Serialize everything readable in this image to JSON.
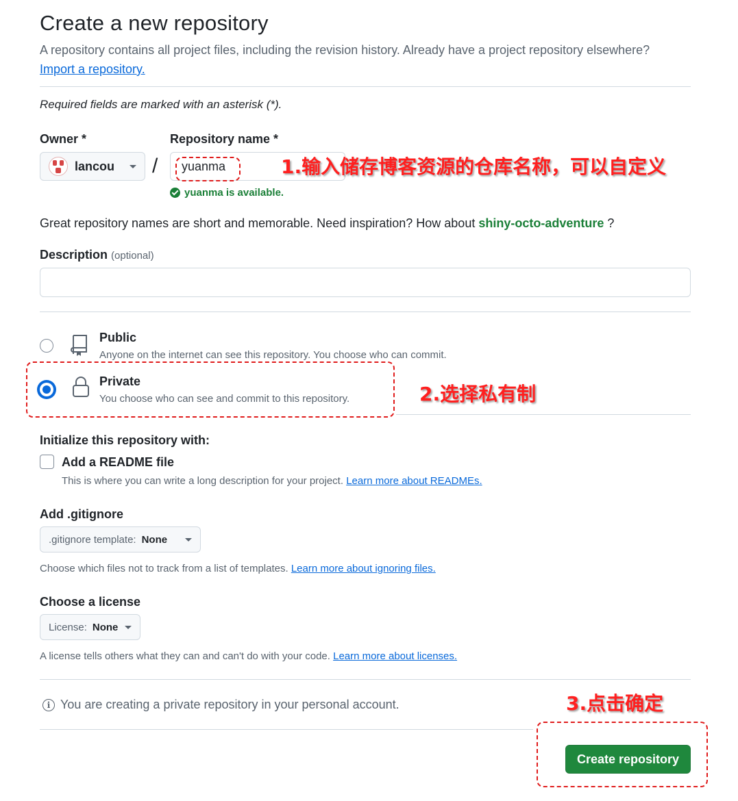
{
  "header": {
    "title": "Create a new repository",
    "subtitle": "A repository contains all project files, including the revision history. Already have a project repository elsewhere?",
    "import_link": "Import a repository."
  },
  "required_note": "Required fields are marked with an asterisk (*).",
  "owner": {
    "label": "Owner *",
    "value": "lancou"
  },
  "separator": "/",
  "repo_name": {
    "label": "Repository name *",
    "value": "yuanma",
    "availability": "yuanma is available."
  },
  "inspiration": {
    "text": "Great repository names are short and memorable. Need inspiration? How about",
    "suggestion": "shiny-octo-adventure",
    "suffix": "?"
  },
  "description": {
    "label": "Description",
    "optional": "(optional)",
    "value": ""
  },
  "visibility": {
    "selected": "private",
    "public": {
      "title": "Public",
      "desc": "Anyone on the internet can see this repository. You choose who can commit."
    },
    "private": {
      "title": "Private",
      "desc": "You choose who can see and commit to this repository."
    }
  },
  "init": {
    "heading": "Initialize this repository with:",
    "readme_label": "Add a README file",
    "readme_checked": false,
    "readme_help": "This is where you can write a long description for your project.",
    "readme_link": "Learn more about READMEs."
  },
  "gitignore": {
    "heading": "Add .gitignore",
    "select_prefix": ".gitignore template:",
    "select_value": "None",
    "help": "Choose which files not to track from a list of templates.",
    "link": "Learn more about ignoring files."
  },
  "license": {
    "heading": "Choose a license",
    "select_prefix": "License:",
    "select_value": "None",
    "help": "A license tells others what they can and can't do with your code.",
    "link": "Learn more about licenses."
  },
  "info_note": "You are creating a private repository in your personal account.",
  "create_button": "Create repository",
  "annotations": {
    "step1": "1.输入储存博客资源的仓库名称，可以自定义",
    "step2": "2.选择私有制",
    "step3": "3.点击确定"
  },
  "colors": {
    "primary_green": "#1f883d",
    "link_blue": "#0969da",
    "annotation_red": "#ff1f1f",
    "success_green": "#1a7f37"
  },
  "icons": [
    "caret-down-icon",
    "check-circle-icon",
    "repo-book-icon",
    "lock-icon",
    "info-icon"
  ]
}
